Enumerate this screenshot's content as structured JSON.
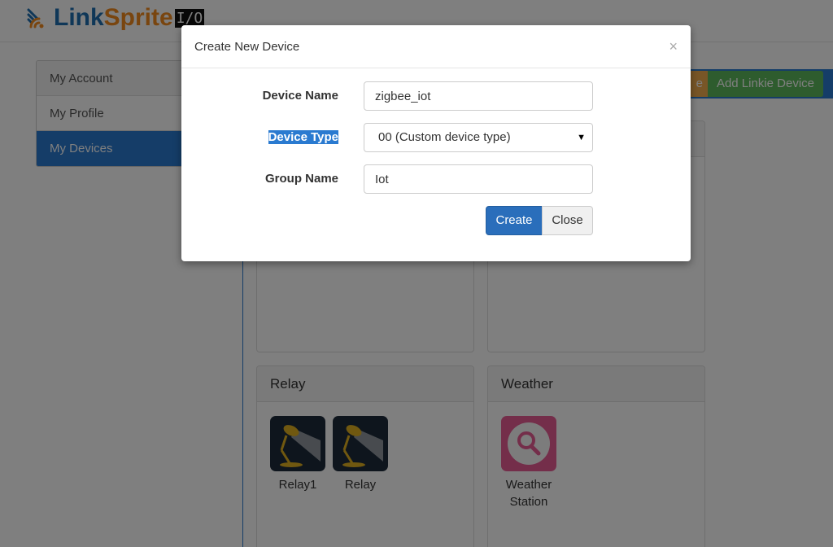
{
  "brand": {
    "link": "Link",
    "sprite": "Sprite",
    "io": "I/O"
  },
  "sidebar": {
    "items": [
      {
        "label": "My Account"
      },
      {
        "label": "My Profile"
      },
      {
        "label": "My Devices"
      }
    ]
  },
  "toolbar": {
    "partial_label": "e",
    "add_linkie_label": "Add Linkie Device"
  },
  "panels": {
    "relay": {
      "title": "Relay",
      "devices": [
        {
          "label": "Relay1",
          "icon": "lamp-icon"
        },
        {
          "label": "Relay",
          "icon": "lamp-icon"
        }
      ]
    },
    "weather": {
      "title": "Weather",
      "devices": [
        {
          "label": "Weather Station",
          "icon": "magnifier-icon"
        }
      ]
    }
  },
  "modal": {
    "title": "Create New Device",
    "close_symbol": "×",
    "fields": {
      "device_name": {
        "label": "Device Name",
        "value": "zigbee_iot"
      },
      "device_type": {
        "label": "Device Type",
        "value": "00 (Custom device type)"
      },
      "group_name": {
        "label": "Group Name",
        "value": "Iot"
      }
    },
    "create_label": "Create",
    "close_label": "Close"
  },
  "colors": {
    "primary": "#2a7ad0",
    "success": "#5cb85c",
    "warning": "#f0ad4e",
    "logo_blue": "#1e6fb0",
    "logo_orange": "#f28b1e",
    "weather_pink": "#e95d95"
  }
}
